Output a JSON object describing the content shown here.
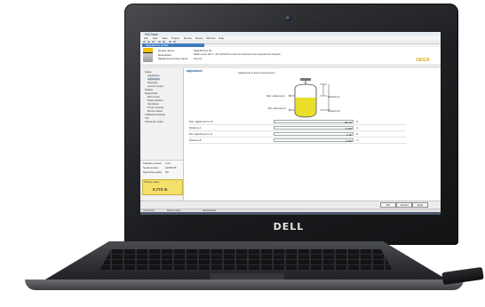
{
  "laptop": {
    "brand": "DELL"
  },
  "app": {
    "title": "PACTware",
    "menu": [
      "File",
      "Edit",
      "View",
      "Project",
      "Device",
      "Extras",
      "Window",
      "Help"
    ],
    "device_tab": "VEGAPULS 62 ER",
    "info": {
      "device_name_key": "Device name:",
      "device_name_val": "VEGAPULS 64",
      "description_key": "Description:",
      "description_val": "Radar sensor with 4...20 mA/HART two-wire for continuous level measurement of liquids",
      "measurement_loop_key": "Measurement loop name:",
      "measurement_loop_val": "Sensor",
      "logo": "VEGA"
    },
    "sidebar": {
      "items": [
        {
          "label": "Setup",
          "indent": 1,
          "selected": false
        },
        {
          "label": "Application",
          "indent": 2,
          "selected": false
        },
        {
          "label": "Adjustment",
          "indent": 2,
          "selected": true
        },
        {
          "label": "Damping",
          "indent": 2,
          "selected": false
        },
        {
          "label": "Current output",
          "indent": 2,
          "selected": false
        },
        {
          "label": "Display",
          "indent": 1,
          "selected": false
        },
        {
          "label": "Diagnostics",
          "indent": 1,
          "selected": false
        },
        {
          "label": "Echo curve",
          "indent": 2,
          "selected": false
        },
        {
          "label": "Peak indicator",
          "indent": 2,
          "selected": false
        },
        {
          "label": "Simulation",
          "indent": 2,
          "selected": false
        },
        {
          "label": "Trend recorder",
          "indent": 2,
          "selected": false
        },
        {
          "label": "Device status",
          "indent": 2,
          "selected": false
        },
        {
          "label": "Additional settings",
          "indent": 1,
          "selected": false
        },
        {
          "label": "Info",
          "indent": 1,
          "selected": false
        },
        {
          "label": "Parameter setup",
          "indent": 1,
          "selected": false
        }
      ],
      "summary": [
        {
          "key": "Software version",
          "value": "1.0.0"
        },
        {
          "key": "Serial number",
          "value": "12345678"
        },
        {
          "key": "Measuring status",
          "value": "OK"
        }
      ],
      "value_box": {
        "label": "Primary value",
        "value": "0.773 m",
        "flag": "i"
      }
    },
    "main": {
      "title": "Adjustment",
      "note": "Adjustment of level measurement",
      "max_label": "Max. adjustment",
      "min_label": "Min. adjustment",
      "distance_a": "Distance A",
      "distance_b": "Distance B",
      "fields": [
        {
          "label": "Max. adjustment in %",
          "value": "100.00",
          "unit": "%"
        },
        {
          "label": "Distance A",
          "value": "0.000",
          "unit": "m"
        },
        {
          "label": "Min. adjustment in %",
          "value": "0.00",
          "unit": "%"
        },
        {
          "label": "Distance B",
          "value": "1.000",
          "unit": "m"
        }
      ]
    },
    "buttons": [
      "OK",
      "Cancel",
      "Apply"
    ],
    "status": [
      "Connected",
      "Device online",
      "Administrator"
    ]
  }
}
